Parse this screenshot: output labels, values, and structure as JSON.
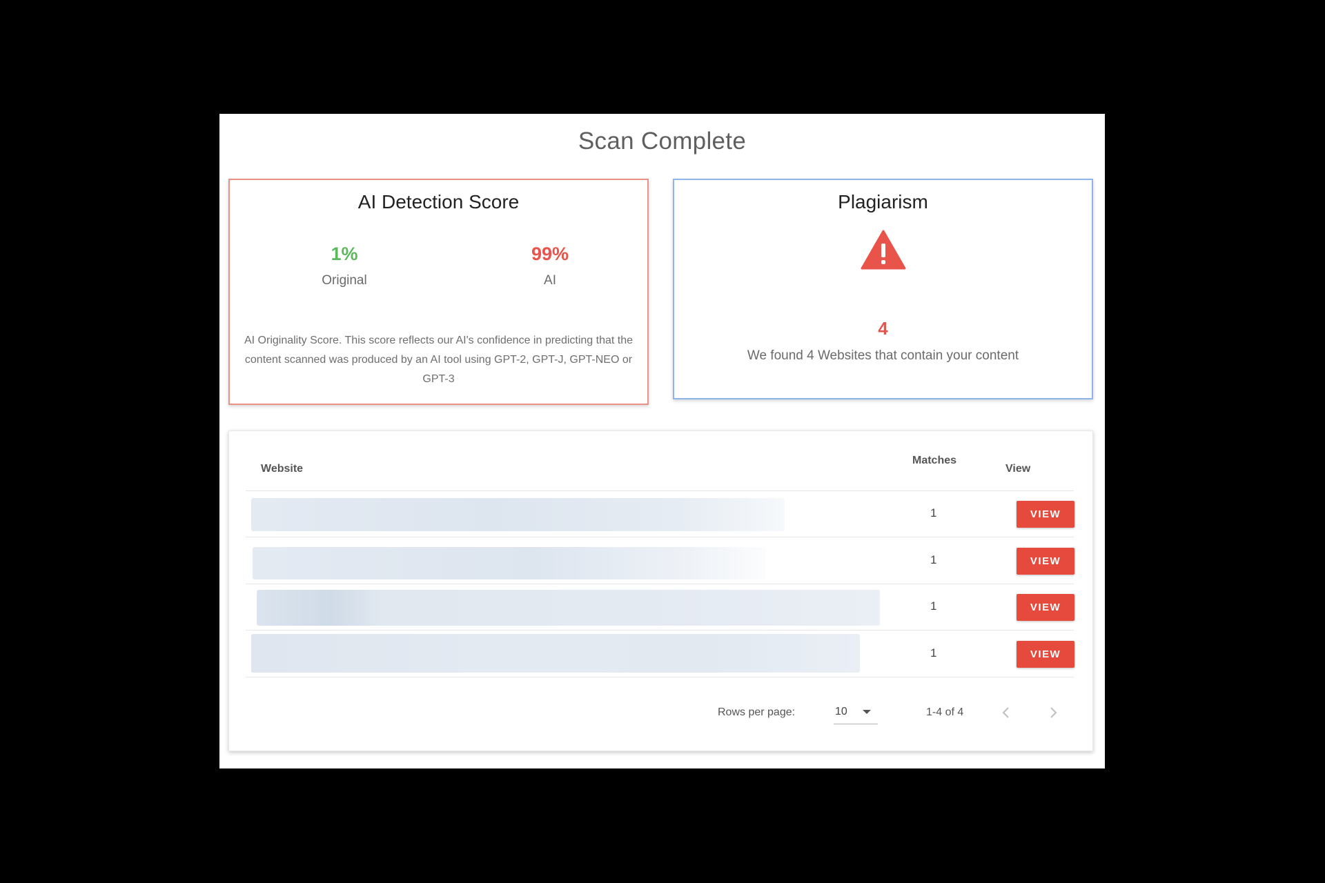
{
  "page": {
    "title": "Scan Complete"
  },
  "ai_card": {
    "title": "AI Detection Score",
    "original": {
      "value": "1%",
      "label": "Original"
    },
    "ai": {
      "value": "99%",
      "label": "AI"
    },
    "description": "AI Originality Score. This score reflects our AI's confidence in predicting that the content scanned was produced by an AI tool using GPT-2, GPT-J, GPT-NEO or GPT-3",
    "border_color": "#ec8f84",
    "original_color": "#5cb85c",
    "ai_color": "#e8534a"
  },
  "plagiarism_card": {
    "title": "Plagiarism",
    "icon": "warning-icon",
    "count": "4",
    "description": "We found 4 Websites that contain your content",
    "border_color": "#8fb4ea",
    "accent_color": "#e8534a"
  },
  "table": {
    "columns": {
      "website": "Website",
      "matches": "Matches",
      "view": "View"
    },
    "rows": [
      {
        "matches": "1",
        "view_label": "VIEW"
      },
      {
        "matches": "1",
        "view_label": "VIEW"
      },
      {
        "matches": "1",
        "view_label": "VIEW"
      },
      {
        "matches": "1",
        "view_label": "VIEW"
      }
    ],
    "button_color": "#e64a3c",
    "pagination": {
      "rows_per_page_label": "Rows per page:",
      "rows_per_page_value": "10",
      "range_text": "1-4 of 4",
      "prev_icon": "chevron-left-icon",
      "next_icon": "chevron-right-icon"
    }
  }
}
